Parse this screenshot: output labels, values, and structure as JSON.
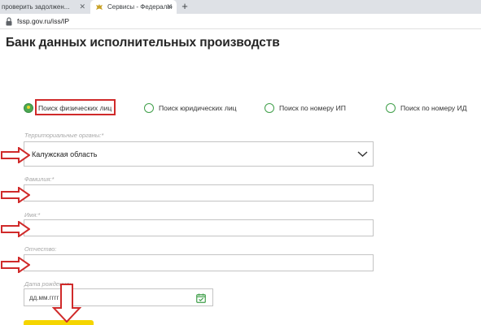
{
  "browser": {
    "tabs": [
      {
        "title": "проверить задолжен..."
      },
      {
        "title": "Сервисы - Федеральная служб"
      }
    ],
    "new_tab_label": "+",
    "close_label": "✕",
    "url": "fssp.gov.ru/iss/IP"
  },
  "page": {
    "title": "Банк данных исполнительных производств",
    "search_types": [
      {
        "label": "Поиск физических лиц",
        "selected": true
      },
      {
        "label": "Поиск юридических лиц",
        "selected": false
      },
      {
        "label": "Поиск по номеру ИП",
        "selected": false
      },
      {
        "label": "Поиск по номеру ИД",
        "selected": false
      }
    ],
    "form": {
      "territory_label": "Территориальные органы:*",
      "territory_value": "Калужская область",
      "surname_label": "Фамилия:*",
      "name_label": "Имя:*",
      "patronymic_label": "Отчество:",
      "birthdate_label": "Дата рождения:",
      "birthdate_placeholder": "дд.мм.гггг"
    }
  },
  "colors": {
    "accent_green": "#4ca852",
    "annotation_red": "#d02a2a",
    "button_yellow": "#f5d500"
  },
  "icons": [
    "lock-icon",
    "emblem-icon",
    "chevron-down-icon",
    "calendar-icon",
    "arrow-right-annotation",
    "arrow-down-annotation"
  ]
}
